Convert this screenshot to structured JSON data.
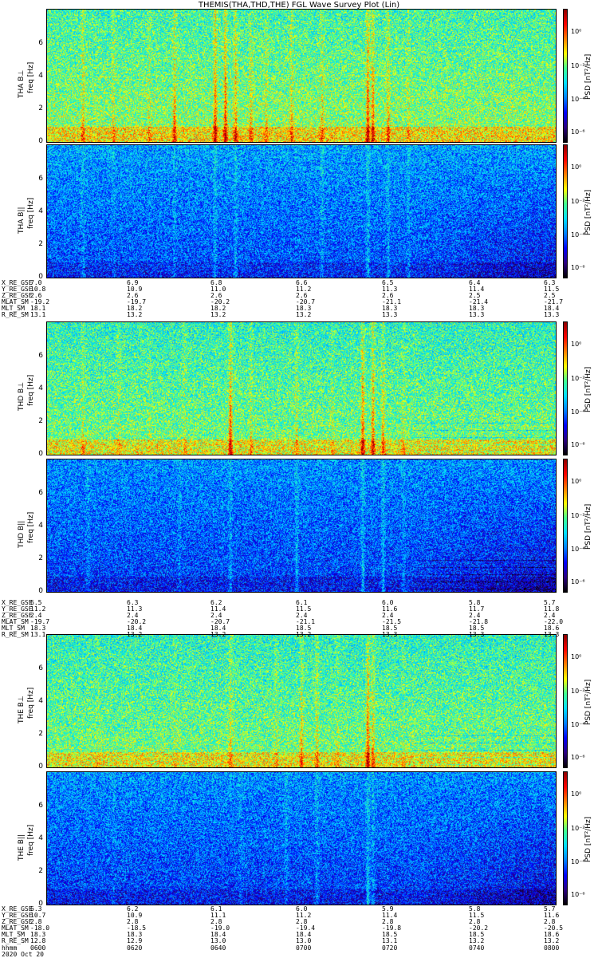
{
  "title": "THEMIS(THA,THD,THE) FGL Wave Survey Plot (Lin)",
  "colorbar": {
    "label": "PSD [nT²/Hz]",
    "ticks": [
      "10⁰",
      "10⁻²",
      "10⁻⁴",
      "10⁻⁶"
    ]
  },
  "panels": [
    {
      "id": "tha-bl",
      "label": "THA B⊥",
      "axis": "freq [Hz]",
      "ticks": [
        "0",
        "2",
        "4",
        "6"
      ],
      "colorbar": "PSD [nT²/Hz]"
    },
    {
      "id": "tha-bpar",
      "label": "THA B||",
      "axis": "freq [Hz]",
      "ticks": [
        "0",
        "2",
        "4",
        "6"
      ],
      "colorbar": "PSD [nT²/Hz]"
    },
    {
      "id": "thd-bl",
      "label": "THD B⊥",
      "axis": "freq [Hz]",
      "ticks": [
        "0",
        "2",
        "4",
        "6"
      ],
      "colorbar": "PSD [nT²/Hz]"
    },
    {
      "id": "thd-bpar",
      "label": "THD B||",
      "axis": "freq [Hz]",
      "ticks": [
        "0",
        "2",
        "4",
        "6"
      ],
      "colorbar": "PSD [nT²/Hz]"
    },
    {
      "id": "the-bl",
      "label": "THE B⊥",
      "axis": "freq [Hz]",
      "ticks": [
        "0",
        "2",
        "4",
        "6"
      ],
      "colorbar": "PSD [nT²/Hz]"
    },
    {
      "id": "the-bpar",
      "label": "THE B||",
      "axis": "freq [Hz]",
      "ticks": [
        "0",
        "2",
        "4",
        "6"
      ],
      "colorbar": "PSD [nT²/Hz]"
    }
  ],
  "ephemeris": [
    {
      "rows": [
        {
          "label": "X_RE_GSE",
          "values": [
            "7.0",
            "6.9",
            "6.8",
            "6.6",
            "6.5",
            "6.4",
            "6.3"
          ]
        },
        {
          "label": "Y_RE_GSE",
          "values": [
            "10.8",
            "10.9",
            "11.0",
            "11.2",
            "11.3",
            "11.4",
            "11.5"
          ]
        },
        {
          "label": "Z_RE_GSE",
          "values": [
            "2.6",
            "2.6",
            "2.6",
            "2.6",
            "2.6",
            "2.5",
            "2.5"
          ]
        },
        {
          "label": "MLAT_SM",
          "values": [
            "-19.2",
            "-19.7",
            "-20.2",
            "-20.7",
            "-21.1",
            "-21.4",
            "-21.7"
          ]
        },
        {
          "label": "MLT_SM",
          "values": [
            "18.1",
            "18.2",
            "18.2",
            "18.3",
            "18.3",
            "18.3",
            "18.4"
          ]
        },
        {
          "label": "R_RE_SM",
          "values": [
            "13.1",
            "13.2",
            "13.2",
            "13.2",
            "13.3",
            "13.3",
            "13.3"
          ]
        }
      ]
    },
    {
      "rows": [
        {
          "label": "X_RE_GSE",
          "values": [
            "6.5",
            "6.3",
            "6.2",
            "6.1",
            "6.0",
            "5.8",
            "5.7"
          ]
        },
        {
          "label": "Y_RE_GSE",
          "values": [
            "11.2",
            "11.3",
            "11.4",
            "11.5",
            "11.6",
            "11.7",
            "11.8"
          ]
        },
        {
          "label": "Z_RE_GSE",
          "values": [
            "2.4",
            "2.4",
            "2.4",
            "2.4",
            "2.4",
            "2.4",
            "2.4"
          ]
        },
        {
          "label": "MLAT_SM",
          "values": [
            "-19.7",
            "-20.2",
            "-20.7",
            "-21.1",
            "-21.5",
            "-21.8",
            "-22.0"
          ]
        },
        {
          "label": "MLT_SM",
          "values": [
            "18.3",
            "18.4",
            "18.4",
            "18.5",
            "18.5",
            "18.5",
            "18.6"
          ]
        },
        {
          "label": "R_RE_SM",
          "values": [
            "13.1",
            "13.2",
            "13.2",
            "13.2",
            "13.3",
            "13.3",
            "13.3"
          ]
        }
      ]
    },
    {
      "rows": [
        {
          "label": "X_RE_GSE",
          "values": [
            "6.3",
            "6.2",
            "6.1",
            "6.0",
            "5.9",
            "5.8",
            "5.7"
          ]
        },
        {
          "label": "Y_RE_GSE",
          "values": [
            "10.7",
            "10.9",
            "11.1",
            "11.2",
            "11.4",
            "11.5",
            "11.6"
          ]
        },
        {
          "label": "Z_RE_GSE",
          "values": [
            "2.8",
            "2.8",
            "2.8",
            "2.8",
            "2.8",
            "2.8",
            "2.8"
          ]
        },
        {
          "label": "MLAT_SM",
          "values": [
            "-18.0",
            "-18.5",
            "-19.0",
            "-19.4",
            "-19.8",
            "-20.2",
            "-20.5"
          ]
        },
        {
          "label": "MLT_SM",
          "values": [
            "18.3",
            "18.3",
            "18.4",
            "18.4",
            "18.5",
            "18.5",
            "18.6"
          ]
        },
        {
          "label": "R_RE_SM",
          "values": [
            "12.8",
            "12.9",
            "13.0",
            "13.0",
            "13.1",
            "13.2",
            "13.2"
          ]
        },
        {
          "label": "hhmm",
          "values": [
            "0600",
            "0620",
            "0640",
            "0700",
            "0720",
            "0740",
            "0800"
          ]
        },
        {
          "label": "2020 Oct 20",
          "values": []
        }
      ]
    }
  ],
  "chart_data": {
    "type": "heatmap",
    "title": "THEMIS(THA,THD,THE) FGL Wave Survey Plot (Lin)",
    "xlabel": "hhmm",
    "date": "2020 Oct 20",
    "x_ticks": [
      "0600",
      "0620",
      "0640",
      "0700",
      "0720",
      "0740",
      "0800"
    ],
    "ylabel": "freq [Hz]",
    "ylim": [
      0,
      8
    ],
    "y_ticks": [
      0,
      2,
      4,
      6
    ],
    "color_label": "PSD [nT²/Hz]",
    "color_scale": "log",
    "color_ticks": [
      "10⁰",
      "10⁻²",
      "10⁻⁴",
      "10⁻⁶"
    ],
    "colormap": [
      "#000000",
      "#2a0080",
      "#0000ff",
      "#0080ff",
      "#00e0ff",
      "#40ff90",
      "#ffff00",
      "#ff8000",
      "#ff0000",
      "#8b0000"
    ],
    "series": [
      {
        "name": "THA B⊥"
      },
      {
        "name": "THA B||"
      },
      {
        "name": "THD B⊥"
      },
      {
        "name": "THD B||"
      },
      {
        "name": "THE B⊥"
      },
      {
        "name": "THE B||"
      }
    ]
  }
}
